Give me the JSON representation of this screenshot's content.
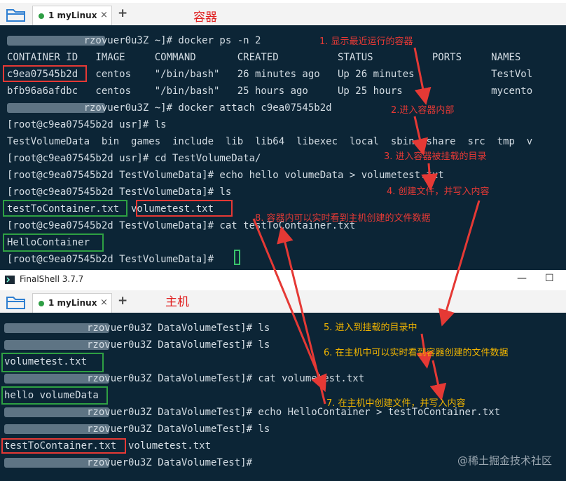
{
  "top_window": {
    "tab_label": "1 myLinux",
    "tab_close": "×",
    "new_tab": "+",
    "section_title": "容器",
    "lines": [
      "             rzovuer0u3Z ~]# docker ps -n 2",
      "CONTAINER ID   IMAGE     COMMAND       CREATED          STATUS          PORTS     NAMES",
      "c9ea07545b2d   centos    \"/bin/bash\"   26 minutes ago   Up 26 minutes             TestVol",
      "bfb96a6afdbc   centos    \"/bin/bash\"   25 hours ago     Up 25 hours               mycento",
      "             rzovuer0u3Z ~]# docker attach c9ea07545b2d",
      "[root@c9ea07545b2d usr]# ls",
      "TestVolumeData  bin  games  include  lib  lib64  libexec  local  sbin  share  src  tmp  v",
      "[root@c9ea07545b2d usr]# cd TestVolumeData/",
      "[root@c9ea07545b2d TestVolumeData]# echo hello volumeData > volumetest.txt",
      "[root@c9ea07545b2d TestVolumeData]# ls",
      "testToContainer.txt  volumetest.txt",
      "[root@c9ea07545b2d TestVolumeData]# cat testToContainer.txt",
      "HelloContainer",
      "[root@c9ea07545b2d TestVolumeData]# "
    ]
  },
  "second_window": {
    "app_title": "FinalShell 3.7.7",
    "minimize": "—",
    "maximize": "☐",
    "tab_label": "1 myLinux",
    "tab_close": "×",
    "new_tab": "+",
    "section_title": "主机",
    "lines": [
      "              rzovuer0u3Z DataVolumeTest]# ls",
      "              rzovuer0u3Z DataVolumeTest]# ls",
      "volumetest.txt",
      "              rzovuer0u3Z DataVolumeTest]# cat volumetest.txt",
      "hello volumeData",
      "              rzovuer0u3Z DataVolumeTest]# echo HelloContainer > testToContainer.txt",
      "              rzovuer0u3Z DataVolumeTest]# ls",
      "testToContainer.txt  volumetest.txt",
      "              rzovuer0u3Z DataVolumeTest]#"
    ]
  },
  "annotations": {
    "a1": "1. 显示最近运行的容器",
    "a2": "2.进入容器内部",
    "a3": "3. 进入容器被挂载的目录",
    "a4": "4. 创建文件，并写入内容",
    "a5": "5. 进入到挂载的目录中",
    "a6": "6. 在主机中可以实时看到容器创建的文件数据",
    "a7": "7. 在主机中创建文件，并写入内容",
    "a8": "8. 容器内可以实时看到主机创建的文件数据"
  },
  "watermark": "@稀土掘金技术社区",
  "colors": {
    "terminal_bg": "#0c2536",
    "terminal_text": "#d4dde4",
    "highlight_red": "#e53935",
    "highlight_green": "#2ea043",
    "annotation_yellow": "#f0b400"
  }
}
